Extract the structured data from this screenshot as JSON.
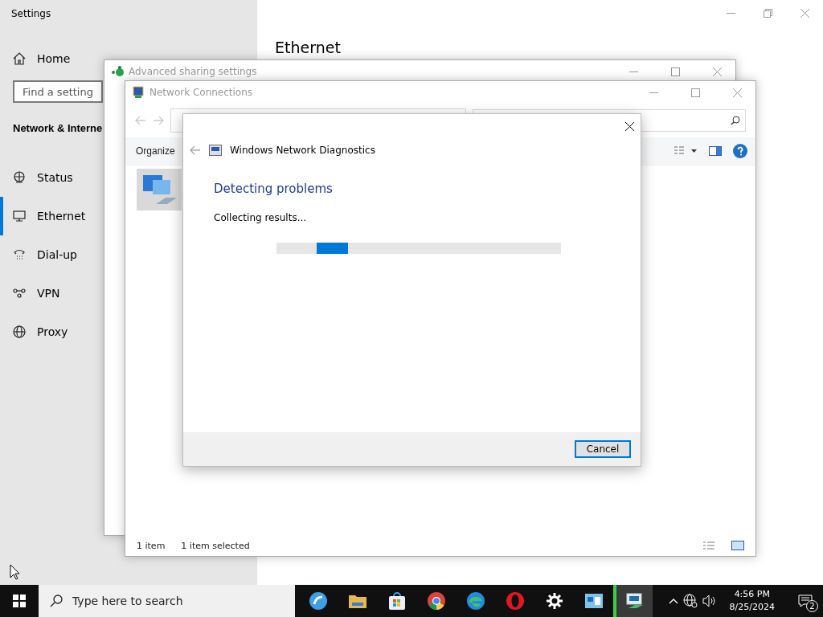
{
  "settings": {
    "title": "Settings",
    "home": "Home",
    "search": {
      "placeholder": "Find a setting"
    },
    "section": "Network & Interne",
    "heading": "Ethernet",
    "nav": [
      {
        "label": "Status",
        "selected": false
      },
      {
        "label": "Ethernet",
        "selected": true
      },
      {
        "label": "Dial-up",
        "selected": false
      },
      {
        "label": "VPN",
        "selected": false
      },
      {
        "label": "Proxy",
        "selected": false
      }
    ]
  },
  "sharing_window": {
    "title": "Advanced sharing settings"
  },
  "connections_window": {
    "title": "Network Connections",
    "toolbar": {
      "organize": "Organize"
    },
    "status_bar": {
      "count": "1 item",
      "selection": "1 item selected"
    }
  },
  "diagnostics": {
    "title": "Windows Network Diagnostics",
    "heading": "Detecting problems",
    "status": "Collecting results...",
    "progress": {
      "level": 0.11
    },
    "cancel": "Cancel"
  },
  "taskbar": {
    "search": {
      "placeholder": "Type here to search"
    },
    "apps": [
      {
        "active": false
      },
      {
        "active": false
      },
      {
        "active": false
      },
      {
        "active": false
      },
      {
        "active": false
      },
      {
        "active": false
      },
      {
        "active": false
      },
      {
        "active": false
      },
      {
        "active": true
      }
    ],
    "time": "4:56 PM",
    "date": "8/25/2024",
    "notifications": "2"
  }
}
